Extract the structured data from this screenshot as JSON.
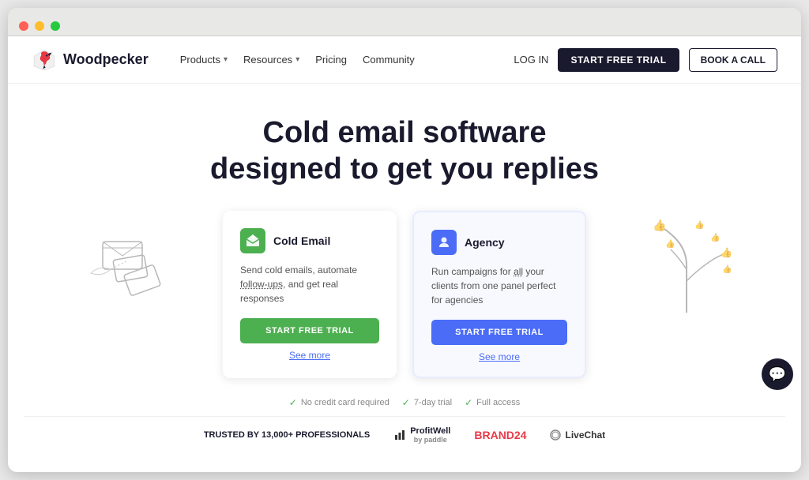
{
  "browser": {
    "dots": [
      "red",
      "yellow",
      "green"
    ]
  },
  "navbar": {
    "logo_text": "Woodpecker",
    "nav_items": [
      {
        "label": "Products",
        "has_dropdown": true
      },
      {
        "label": "Resources",
        "has_dropdown": true
      },
      {
        "label": "Pricing",
        "has_dropdown": false
      },
      {
        "label": "Community",
        "has_dropdown": false
      }
    ],
    "btn_login": "LOG IN",
    "btn_start_trial": "START FREE TRIAL",
    "btn_book_call": "BOOK A CALL"
  },
  "hero": {
    "title_line1": "Cold email software",
    "title_line2": "designed to get you replies"
  },
  "cards": [
    {
      "id": "cold-email",
      "icon_color": "green",
      "icon_label": "W",
      "title": "Cold Email",
      "description": "Send cold emails, automate follow-ups, and get real responses",
      "cta": "START FREE TRIAL",
      "see_more": "See more",
      "cta_style": "green"
    },
    {
      "id": "agency",
      "icon_color": "blue",
      "icon_label": "W",
      "title": "Agency",
      "description": "Run campaigns for all your clients from one panel perfect for agencies",
      "cta": "START FREE TRIAL",
      "see_more": "See more",
      "cta_style": "blue"
    }
  ],
  "trust_items": [
    {
      "text": "No credit card required"
    },
    {
      "text": "7-day trial"
    },
    {
      "text": "Full access"
    }
  ],
  "bottom_bar": {
    "trusted_prefix": "TRUSTED",
    "trusted_suffix": "BY 13,000+ PROFESSIONALS",
    "brands": [
      {
        "name": "ProfitWell",
        "sub": "by paddle",
        "style": "normal"
      },
      {
        "name": "BRAND24",
        "style": "brand24"
      },
      {
        "name": "LiveChat",
        "style": "livechat"
      }
    ]
  },
  "chat_bubble": {
    "icon": "💬"
  }
}
